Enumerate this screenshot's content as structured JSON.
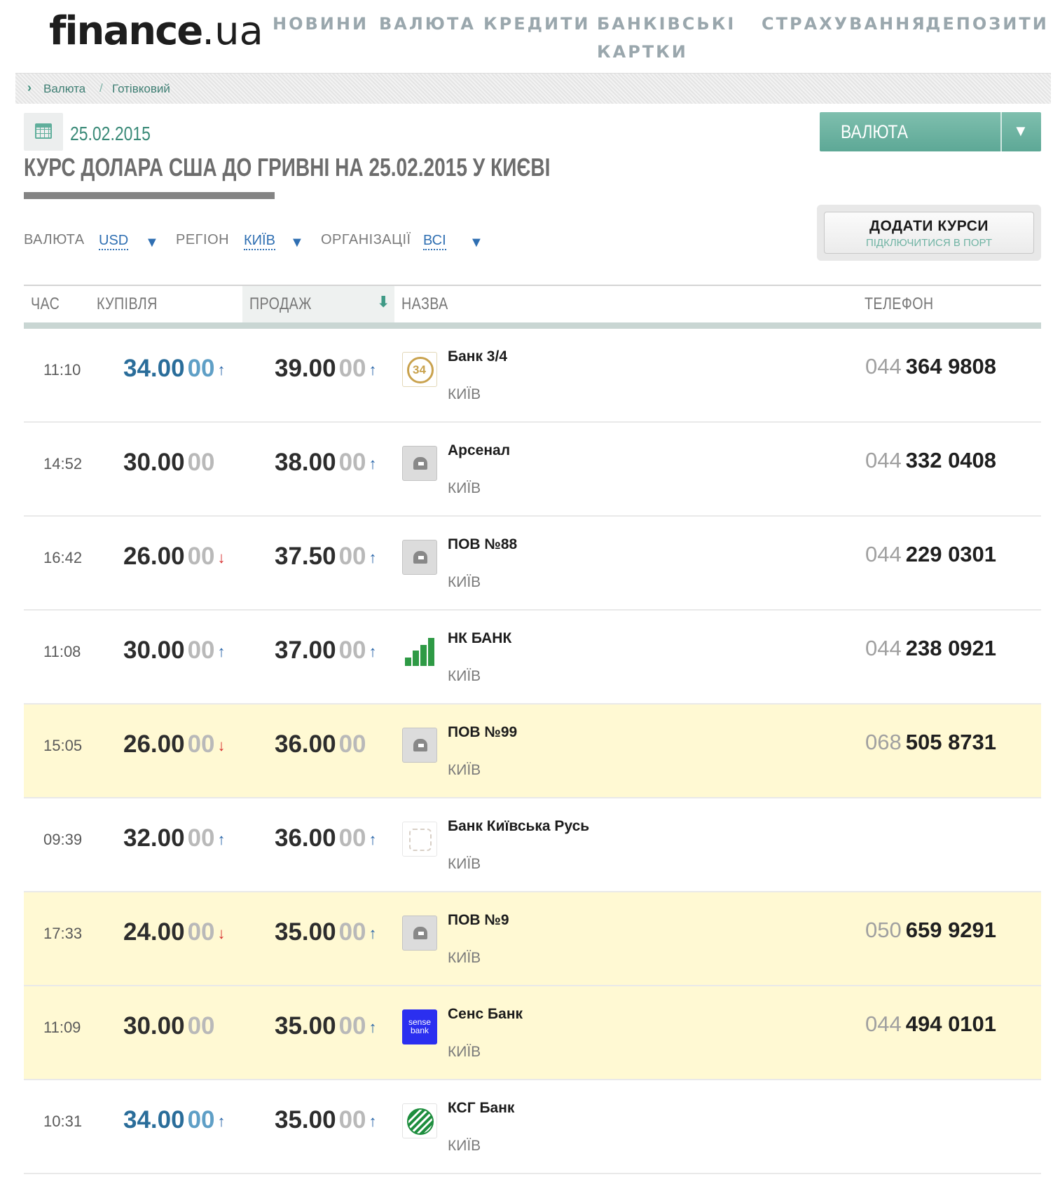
{
  "site": {
    "logo_main": "finance",
    "logo_tld": ".ua",
    "nav": [
      "НОВИНИ",
      "ВАЛЮТА",
      "КРЕДИТИ",
      "БАНКІВСЬКІ",
      "КАРТКИ",
      "СТРАХУВАННЯ",
      "ДЕПОЗИТИ"
    ]
  },
  "breadcrumb": [
    "Валюта",
    "Готівковий"
  ],
  "date": "25.02.2015",
  "title": "КУРС ДОЛАРА США ДО ГРИВНІ НА 25.02.2015 У КИЄВІ",
  "currency_button": "ВАЛЮТА",
  "add_rates": {
    "title": "ДОДАТИ КУРСИ",
    "subtitle": "ПІДКЛЮЧИТИСЯ В ПОРТ"
  },
  "filters": {
    "currency_label": "ВАЛЮТА",
    "currency_value": "USD",
    "region_label": "РЕГІОН",
    "region_value": "КИЇВ",
    "org_label": "ОРГАНІЗАЦІЇ",
    "org_value": "ВСІ"
  },
  "table": {
    "columns": [
      "ЧАС",
      "КУПІВЛЯ",
      "ПРОДАЖ",
      "НАЗВА",
      "ТЕЛЕФОН"
    ],
    "rows": [
      {
        "time": "11:10",
        "buy": "34.00",
        "buy_frac": "00",
        "buy_trend": "up",
        "buy_accent": true,
        "sell": "39.00",
        "sell_frac": "00",
        "sell_trend": "up",
        "logo": "bank34",
        "name": "Банк 3/4",
        "city": "КИЇВ",
        "phone_code": "044",
        "phone_num": "364 9808",
        "highlight": false
      },
      {
        "time": "14:52",
        "buy": "30.00",
        "buy_frac": "00",
        "buy_trend": "",
        "buy_accent": false,
        "sell": "38.00",
        "sell_frac": "00",
        "sell_trend": "up",
        "logo": "generic",
        "name": "Арсенал",
        "city": "КИЇВ",
        "phone_code": "044",
        "phone_num": "332 0408",
        "highlight": false
      },
      {
        "time": "16:42",
        "buy": "26.00",
        "buy_frac": "00",
        "buy_trend": "down",
        "buy_accent": false,
        "sell": "37.50",
        "sell_frac": "00",
        "sell_trend": "up",
        "logo": "generic",
        "name": "ПОВ №88",
        "city": "КИЇВ",
        "phone_code": "044",
        "phone_num": "229 0301",
        "highlight": false
      },
      {
        "time": "11:08",
        "buy": "30.00",
        "buy_frac": "00",
        "buy_trend": "up",
        "buy_accent": false,
        "sell": "37.00",
        "sell_frac": "00",
        "sell_trend": "up",
        "logo": "nk",
        "name": "НК БАНК",
        "city": "КИЇВ",
        "phone_code": "044",
        "phone_num": "238 0921",
        "highlight": false
      },
      {
        "time": "15:05",
        "buy": "26.00",
        "buy_frac": "00",
        "buy_trend": "down",
        "buy_accent": false,
        "sell": "36.00",
        "sell_frac": "00",
        "sell_trend": "",
        "logo": "generic",
        "name": "ПОВ №99",
        "city": "КИЇВ",
        "phone_code": "068",
        "phone_num": "505 8731",
        "highlight": true
      },
      {
        "time": "09:39",
        "buy": "32.00",
        "buy_frac": "00",
        "buy_trend": "up",
        "buy_accent": false,
        "sell": "36.00",
        "sell_frac": "00",
        "sell_trend": "up",
        "logo": "kyivrus",
        "name": "Банк Київська Русь",
        "city": "КИЇВ",
        "phone_code": "",
        "phone_num": "",
        "highlight": false
      },
      {
        "time": "17:33",
        "buy": "24.00",
        "buy_frac": "00",
        "buy_trend": "down",
        "buy_accent": false,
        "sell": "35.00",
        "sell_frac": "00",
        "sell_trend": "up",
        "logo": "generic",
        "name": "ПОВ №9",
        "city": "КИЇВ",
        "phone_code": "050",
        "phone_num": "659 9291",
        "highlight": true
      },
      {
        "time": "11:09",
        "buy": "30.00",
        "buy_frac": "00",
        "buy_trend": "",
        "buy_accent": false,
        "sell": "35.00",
        "sell_frac": "00",
        "sell_trend": "up",
        "logo": "sense",
        "name": "Сенс Банк",
        "city": "КИЇВ",
        "phone_code": "044",
        "phone_num": "494 0101",
        "highlight": true
      },
      {
        "time": "10:31",
        "buy": "34.00",
        "buy_frac": "00",
        "buy_trend": "up",
        "buy_accent": true,
        "sell": "35.00",
        "sell_frac": "00",
        "sell_trend": "up",
        "logo": "ksg",
        "name": "КСГ Банк",
        "city": "КИЇВ",
        "phone_code": "",
        "phone_num": "",
        "highlight": false
      }
    ]
  },
  "logo_texts": {
    "sense": "sense bank"
  },
  "colors": {
    "accent_green": "#5da896",
    "link_blue": "#2f6fb2",
    "highlight": "#fff9d3",
    "up": "#2563a8",
    "down": "#d62a2a"
  },
  "icons": {
    "up": "↑",
    "down": "↓",
    "sort": "⬇",
    "caret": "▼",
    "chevron": "›"
  }
}
